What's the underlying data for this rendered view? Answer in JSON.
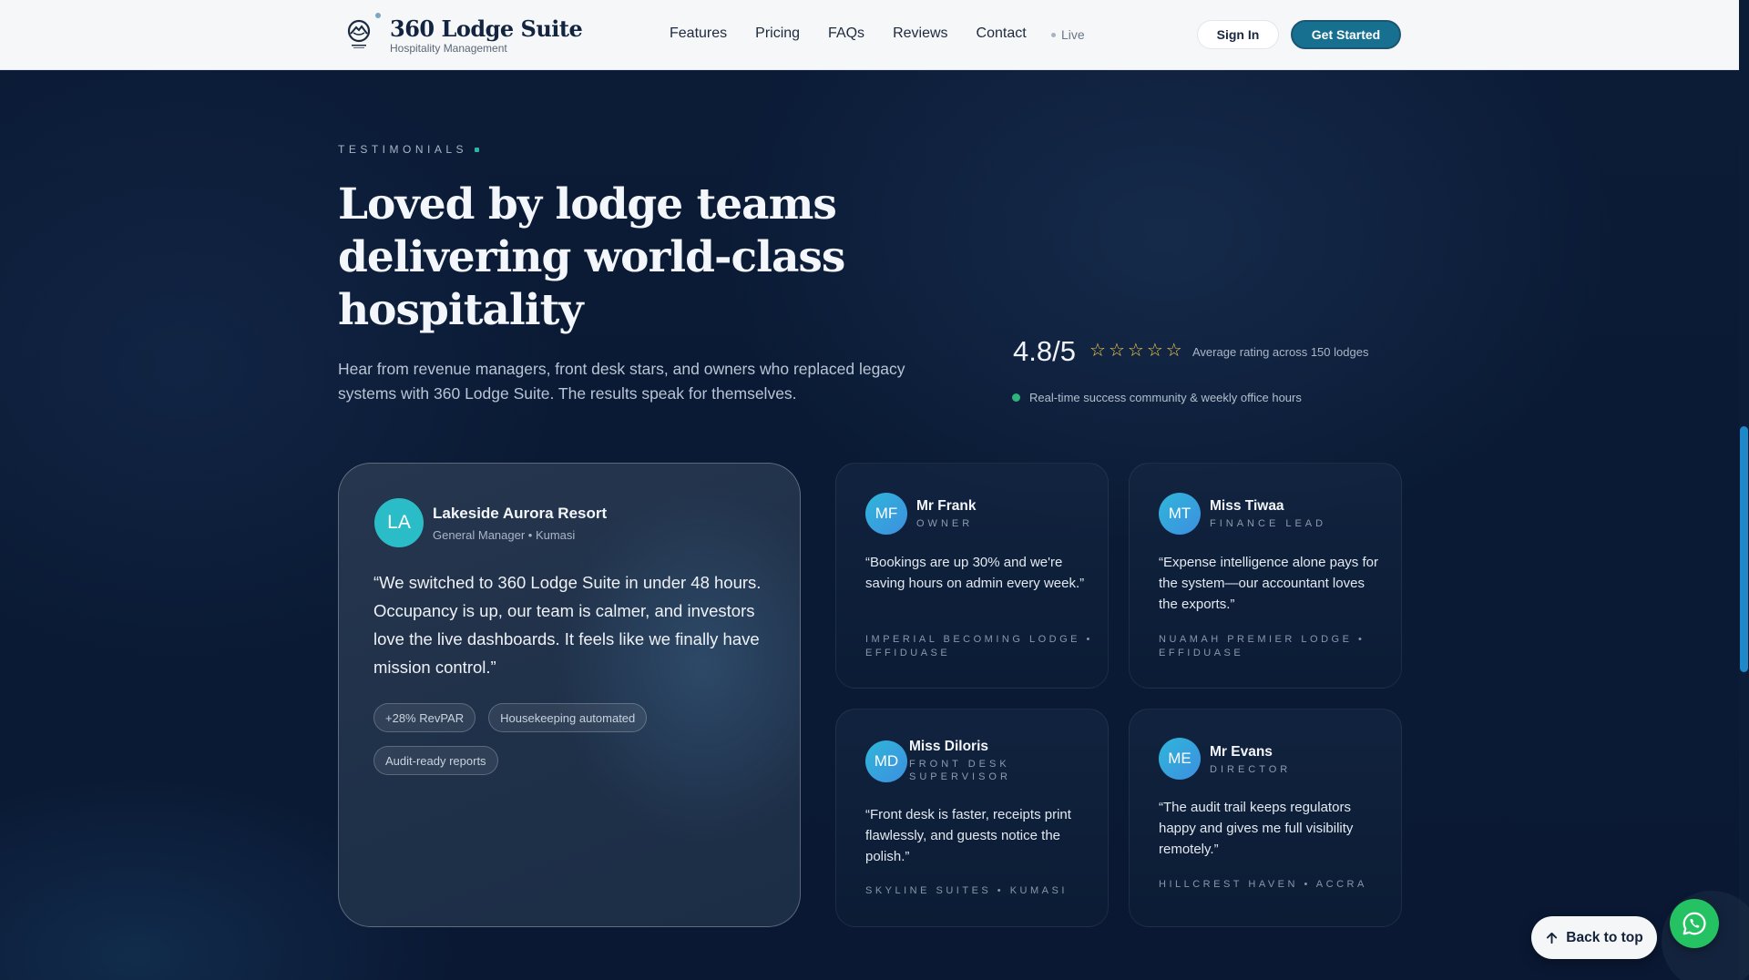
{
  "brand": {
    "name": "360 Lodge Suite",
    "tagline": "Hospitality Management"
  },
  "nav": {
    "items": [
      "Features",
      "Pricing",
      "FAQs",
      "Reviews",
      "Contact"
    ],
    "live_label": "Live",
    "signin_label": "Sign In",
    "get_started_label": "Get Started"
  },
  "hero": {
    "eyebrow": "TESTIMONIALS",
    "headline": "Loved by lodge teams delivering world-class hospitality",
    "lede": "Hear from revenue managers, front desk stars, and owners who replaced legacy systems with 360 Lodge Suite. The results speak for themselves.",
    "rating": "4.8/5",
    "star_count": 5,
    "rating_note": "Average rating across 150 lodges",
    "community": "Real-time success community & weekly office hours"
  },
  "featured": {
    "initials": "LA",
    "name": "Lakeside Aurora Resort",
    "role": "General Manager • Kumasi",
    "quote": "“We switched to 360 Lodge Suite in under 48 hours. Occupancy is up, our team is calmer, and investors love the live dashboards. It feels like we finally have mission control.”",
    "chips": [
      "+28% RevPAR",
      "Housekeeping automated",
      "Audit-ready reports"
    ]
  },
  "testimonials": [
    {
      "initials": "MF",
      "name": "Mr Frank",
      "role": "OWNER",
      "quote": "“Bookings are up 30% and we're saving hours on admin every week.”",
      "org": "IMPERIAL BECOMING LODGE • EFFIDUASE"
    },
    {
      "initials": "MT",
      "name": "Miss Tiwaa",
      "role": "FINANCE LEAD",
      "quote": "“Expense intelligence alone pays for the system—our accountant loves the exports.”",
      "org": "NUAMAH PREMIER LODGE • EFFIDUASE"
    },
    {
      "initials": "MD",
      "name": "Miss Diloris",
      "role": "FRONT DESK SUPERVISOR",
      "quote": "“Front desk is faster, receipts print flawlessly, and guests notice the polish.”",
      "org": "SKYLINE SUITES • KUMASI"
    },
    {
      "initials": "ME",
      "name": "Mr Evans",
      "role": "DIRECTOR",
      "quote": "“The audit trail keeps regulators happy and gives me full visibility remotely.”",
      "org": "HILLCREST HAVEN • ACCRA"
    }
  ],
  "floating": {
    "back_to_top": "Back to top"
  },
  "icons": {
    "logo": "mountain-circle-logo",
    "back_arrow": "arrow-up-icon",
    "whatsapp": "whatsapp-icon",
    "star": "star-outline-icon"
  },
  "colors": {
    "accent": "#17708f",
    "star": "#f2c94c",
    "whatsapp": "#25c263",
    "live_dot": "#2fb37a"
  }
}
